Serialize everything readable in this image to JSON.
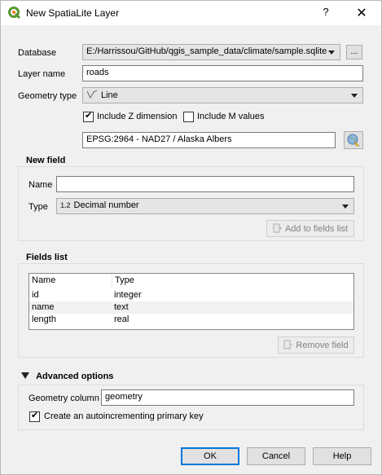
{
  "window": {
    "title": "New SpatiaLite Layer",
    "help_label": "?",
    "close_label": "✕"
  },
  "form": {
    "database_label": "Database",
    "database_value": "E:/Harrissou/GitHub/qgis_sample_data/climate/sample.sqlite",
    "browse_label": "...",
    "layer_name_label": "Layer name",
    "layer_name_value": "roads",
    "geometry_type_label": "Geometry type",
    "geometry_type_value": "Line",
    "geometry_type_icon": "line-geometry-icon",
    "include_z_label": "Include Z dimension",
    "include_z_checked": true,
    "include_m_label": "Include M values",
    "include_m_checked": false,
    "crs_value": "EPSG:2964 - NAD27 / Alaska Albers",
    "crs_select_icon": "crs-globe-icon"
  },
  "new_field": {
    "title": "New field",
    "name_label": "Name",
    "name_value": "",
    "type_label": "Type",
    "type_prefix": "1.2",
    "type_value": "Decimal number",
    "add_button_label": "Add to fields list",
    "add_button_icon": "add-field-icon"
  },
  "fields_list": {
    "title": "Fields list",
    "columns": [
      "Name",
      "Type"
    ],
    "rows": [
      {
        "name": "id",
        "type": "integer"
      },
      {
        "name": "name",
        "type": "text"
      },
      {
        "name": "length",
        "type": "real"
      }
    ],
    "remove_button_label": "Remove field",
    "remove_button_icon": "remove-field-icon"
  },
  "advanced": {
    "title": "Advanced options",
    "geometry_column_label": "Geometry column",
    "geometry_column_value": "geometry",
    "autoincrement_label": "Create an autoincrementing primary key",
    "autoincrement_checked": true
  },
  "buttons": {
    "ok_label": "OK",
    "cancel_label": "Cancel",
    "help_label": "Help"
  },
  "colors": {
    "accent": "#0078d7",
    "dialog_bg": "#f0f0f0"
  }
}
